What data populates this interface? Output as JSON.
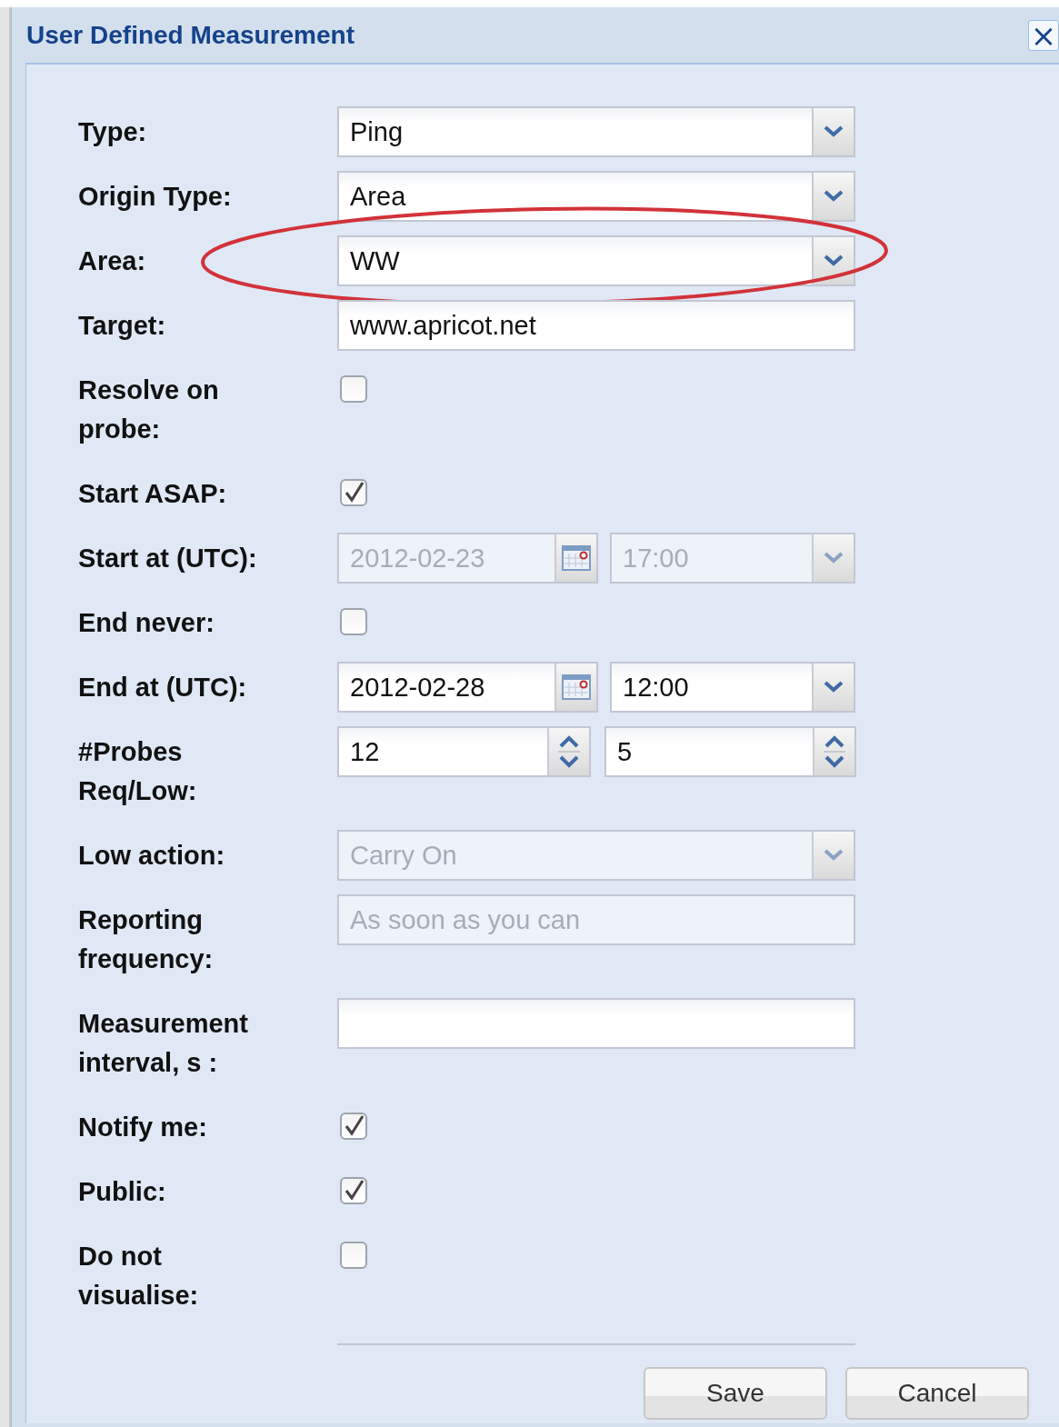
{
  "window": {
    "title": "User Defined Measurement",
    "close": "×"
  },
  "fields": [
    {
      "kind": "select",
      "label": "Type:",
      "value": "Ping",
      "disabled": false,
      "highlighted": false
    },
    {
      "kind": "select",
      "label": "Origin Type:",
      "value": "Area",
      "disabled": false,
      "highlighted": false
    },
    {
      "kind": "select",
      "label": "Area:",
      "value": "WW",
      "disabled": false,
      "highlighted": true
    },
    {
      "kind": "text",
      "label": "Target:",
      "value": "www.apricot.net",
      "disabled": false
    },
    {
      "kind": "checkbox",
      "label": "Resolve on probe:",
      "checked": false
    },
    {
      "kind": "checkbox",
      "label": "Start ASAP:",
      "checked": true
    },
    {
      "kind": "datetime",
      "label": "Start at (UTC):",
      "date": "2012-02-23",
      "time": "17:00",
      "disabled": true
    },
    {
      "kind": "checkbox",
      "label": "End never:",
      "checked": false
    },
    {
      "kind": "datetime",
      "label": "End at (UTC):",
      "date": "2012-02-28",
      "time": "12:00",
      "disabled": false
    },
    {
      "kind": "spinners",
      "label": "#Probes Req/Low:",
      "values": [
        "12",
        "5"
      ]
    },
    {
      "kind": "select",
      "label": "Low action:",
      "value": "Carry On",
      "disabled": true,
      "highlighted": false
    },
    {
      "kind": "text",
      "label": "Reporting frequency:",
      "value": "As soon as you can",
      "disabled": true
    },
    {
      "kind": "text",
      "label": "Measurement interval, s :",
      "disabled": false
    },
    {
      "kind": "checkbox",
      "label": "Notify me:",
      "checked": true
    },
    {
      "kind": "checkbox",
      "label": "Public:",
      "checked": true
    },
    {
      "kind": "checkbox",
      "label": "Do not visualise:",
      "checked": false
    }
  ],
  "buttons": [
    "Save",
    "Cancel"
  ]
}
